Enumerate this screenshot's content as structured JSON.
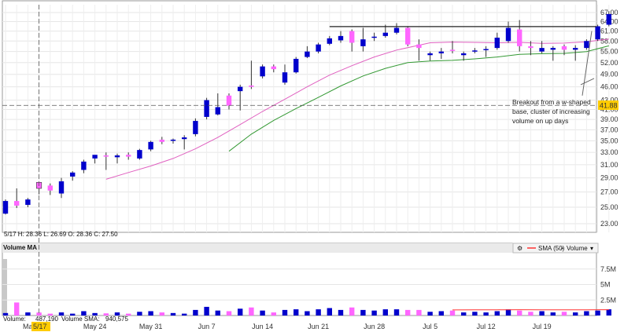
{
  "chart_data": [
    {
      "type": "candlestick",
      "title": "",
      "ylim": [
        22,
        68
      ],
      "y_ticks": [
        "23.00",
        "25.00",
        "27.00",
        "29.00",
        "31.00",
        "33.00",
        "35.00",
        "37.00",
        "39.00",
        "41.00",
        "43.00",
        "46.00",
        "49.00",
        "52.00",
        "55.00",
        "58.00",
        "61.00",
        "64.00",
        "67.00"
      ],
      "x_ticks": [
        "May 24",
        "May 31",
        "Jun 7",
        "Jun 14",
        "Jun 21",
        "Jun 28",
        "Jul 5",
        "Jul 12",
        "Jul 19"
      ],
      "crosshair_date_label": "5/17",
      "crosshair_month_fragment": "Ma",
      "highlight_price_label": "41.88",
      "info_label": "5/17  H: 28.36  L: 26.69  O: 28.36  C: 27.50",
      "candles": [
        {
          "o": 24.2,
          "h": 26.0,
          "l": 24.1,
          "c": 25.8,
          "up": true
        },
        {
          "o": 25.8,
          "h": 27.5,
          "l": 24.9,
          "c": 25.2,
          "up": false
        },
        {
          "o": 25.3,
          "h": 26.2,
          "l": 25.0,
          "c": 26.0,
          "up": true
        },
        {
          "o": 28.36,
          "h": 28.36,
          "l": 26.69,
          "c": 27.5,
          "up": false
        },
        {
          "o": 27.9,
          "h": 28.2,
          "l": 26.6,
          "c": 27.2,
          "up": false
        },
        {
          "o": 26.8,
          "h": 29.0,
          "l": 26.2,
          "c": 28.5,
          "up": true
        },
        {
          "o": 29.2,
          "h": 30.0,
          "l": 28.6,
          "c": 29.8,
          "up": true
        },
        {
          "o": 30.2,
          "h": 31.8,
          "l": 29.7,
          "c": 31.5,
          "up": true
        },
        {
          "o": 32.0,
          "h": 32.5,
          "l": 31.2,
          "c": 32.6,
          "up": true
        },
        {
          "o": 32.5,
          "h": 33.0,
          "l": 30.2,
          "c": 32.3,
          "up": false
        },
        {
          "o": 32.2,
          "h": 32.8,
          "l": 31.2,
          "c": 32.5,
          "up": true
        },
        {
          "o": 32.6,
          "h": 33.0,
          "l": 31.8,
          "c": 32.3,
          "up": false
        },
        {
          "o": 32.0,
          "h": 33.6,
          "l": 31.8,
          "c": 33.4,
          "up": true
        },
        {
          "o": 33.5,
          "h": 35.0,
          "l": 33.2,
          "c": 34.8,
          "up": true
        },
        {
          "o": 35.2,
          "h": 35.7,
          "l": 34.4,
          "c": 34.8,
          "up": false
        },
        {
          "o": 35.0,
          "h": 35.4,
          "l": 34.5,
          "c": 35.2,
          "up": true
        },
        {
          "o": 35.3,
          "h": 36.0,
          "l": 33.5,
          "c": 35.6,
          "up": true
        },
        {
          "o": 36.2,
          "h": 39.2,
          "l": 35.8,
          "c": 38.7,
          "up": true
        },
        {
          "o": 39.5,
          "h": 43.5,
          "l": 39.0,
          "c": 43.0,
          "up": true
        },
        {
          "o": 40.0,
          "h": 44.5,
          "l": 39.8,
          "c": 41.5,
          "up": true
        },
        {
          "o": 44.0,
          "h": 44.5,
          "l": 41.0,
          "c": 41.8,
          "up": false
        },
        {
          "o": 45.0,
          "h": 46.5,
          "l": 40.8,
          "c": 46.0,
          "up": true
        },
        {
          "o": 46.0,
          "h": 52.5,
          "l": 45.5,
          "c": 46.3,
          "up": false
        },
        {
          "o": 48.5,
          "h": 51.5,
          "l": 48.0,
          "c": 51.0,
          "up": true
        },
        {
          "o": 51.0,
          "h": 51.5,
          "l": 49.5,
          "c": 50.3,
          "up": false
        },
        {
          "o": 47.0,
          "h": 51.5,
          "l": 46.5,
          "c": 49.5,
          "up": true
        },
        {
          "o": 49.5,
          "h": 53.5,
          "l": 49.2,
          "c": 53.0,
          "up": true
        },
        {
          "o": 53.5,
          "h": 56.5,
          "l": 53.2,
          "c": 55.0,
          "up": true
        },
        {
          "o": 55.0,
          "h": 57.5,
          "l": 54.5,
          "c": 57.0,
          "up": true
        },
        {
          "o": 57.2,
          "h": 59.5,
          "l": 56.8,
          "c": 58.8,
          "up": true
        },
        {
          "o": 58.2,
          "h": 61.0,
          "l": 57.5,
          "c": 59.5,
          "up": true
        },
        {
          "o": 61.0,
          "h": 61.5,
          "l": 55.0,
          "c": 57.5,
          "up": false
        },
        {
          "o": 56.5,
          "h": 62.0,
          "l": 55.0,
          "c": 58.5,
          "up": true
        },
        {
          "o": 59.0,
          "h": 60.5,
          "l": 58.0,
          "c": 59.3,
          "up": true
        },
        {
          "o": 59.5,
          "h": 63.0,
          "l": 59.0,
          "c": 60.5,
          "up": true
        },
        {
          "o": 60.5,
          "h": 63.5,
          "l": 60.0,
          "c": 62.0,
          "up": true
        },
        {
          "o": 62.0,
          "h": 62.5,
          "l": 56.5,
          "c": 57.0,
          "up": false
        },
        {
          "o": 57.0,
          "h": 58.5,
          "l": 52.5,
          "c": 56.0,
          "up": false
        },
        {
          "o": 54.0,
          "h": 55.0,
          "l": 52.5,
          "c": 54.5,
          "up": true
        },
        {
          "o": 54.5,
          "h": 56.0,
          "l": 53.0,
          "c": 55.0,
          "up": true
        },
        {
          "o": 55.5,
          "h": 58.0,
          "l": 54.5,
          "c": 55.3,
          "up": false
        },
        {
          "o": 54.0,
          "h": 55.0,
          "l": 52.5,
          "c": 54.5,
          "up": true
        },
        {
          "o": 55.0,
          "h": 56.0,
          "l": 54.5,
          "c": 55.3,
          "up": true
        },
        {
          "o": 55.5,
          "h": 56.5,
          "l": 53.5,
          "c": 55.7,
          "up": true
        },
        {
          "o": 56.0,
          "h": 60.5,
          "l": 55.5,
          "c": 59.0,
          "up": true
        },
        {
          "o": 58.0,
          "h": 64.0,
          "l": 57.5,
          "c": 62.0,
          "up": true
        },
        {
          "o": 61.5,
          "h": 64.5,
          "l": 55.0,
          "c": 56.5,
          "up": false
        },
        {
          "o": 56.0,
          "h": 58.0,
          "l": 54.0,
          "c": 56.5,
          "up": false
        },
        {
          "o": 55.0,
          "h": 58.0,
          "l": 54.5,
          "c": 56.0,
          "up": true
        },
        {
          "o": 55.5,
          "h": 56.5,
          "l": 52.5,
          "c": 56.0,
          "up": true
        },
        {
          "o": 56.5,
          "h": 57.0,
          "l": 54.0,
          "c": 55.5,
          "up": false
        },
        {
          "o": 55.5,
          "h": 56.8,
          "l": 52.5,
          "c": 56.0,
          "up": true
        },
        {
          "o": 56.0,
          "h": 58.5,
          "l": 55.5,
          "c": 58.0,
          "up": true
        },
        {
          "o": 58.5,
          "h": 63.0,
          "l": 58.0,
          "c": 62.5,
          "up": true
        },
        {
          "o": 63.0,
          "h": 67.5,
          "l": 62.5,
          "c": 66.5,
          "up": true
        }
      ],
      "sma_pink": [
        [
          9,
          28.8
        ],
        [
          11,
          29.8
        ],
        [
          13,
          30.8
        ],
        [
          15,
          32.0
        ],
        [
          17,
          33.6
        ],
        [
          19,
          35.6
        ],
        [
          21,
          38.0
        ],
        [
          23,
          40.6
        ],
        [
          25,
          43.2
        ],
        [
          27,
          46.0
        ],
        [
          29,
          48.8
        ],
        [
          31,
          51.2
        ],
        [
          33,
          53.5
        ],
        [
          35,
          55.4
        ],
        [
          37,
          56.8
        ],
        [
          38,
          57.5
        ],
        [
          40,
          57.7
        ],
        [
          42,
          57.6
        ],
        [
          44,
          57.5
        ],
        [
          46,
          57.6
        ],
        [
          48,
          57.3
        ],
        [
          50,
          57.4
        ],
        [
          52,
          57.8
        ],
        [
          54,
          58.6
        ]
      ],
      "sma_green": [
        [
          20,
          33.2
        ],
        [
          22,
          36.2
        ],
        [
          24,
          38.8
        ],
        [
          26,
          41.2
        ],
        [
          28,
          43.6
        ],
        [
          30,
          46.2
        ],
        [
          32,
          48.6
        ],
        [
          34,
          50.5
        ],
        [
          36,
          52.0
        ],
        [
          38,
          52.4
        ],
        [
          40,
          52.6
        ],
        [
          42,
          53.0
        ],
        [
          44,
          53.5
        ],
        [
          46,
          54.2
        ],
        [
          48,
          54.4
        ],
        [
          50,
          54.5
        ],
        [
          52,
          55.0
        ],
        [
          54,
          56.6
        ]
      ],
      "resistance_level": 62.4,
      "crosshair_price": 41.88,
      "annotation": [
        "Breakout from a w-shaped",
        "base, cluster of increasing",
        "volume on up days"
      ]
    },
    {
      "type": "bar",
      "title": "Volume MA",
      "legend": [
        "SMA (50)",
        "Volume"
      ],
      "y_ticks": [
        "2.5M",
        "5M",
        "7.5M"
      ],
      "ylim": [
        0,
        10000000
      ],
      "volume_label": "Volume:",
      "volume_value": "487,190",
      "sma_label": "Volume SMA:",
      "sma_value": "940,575",
      "volumes": [
        400000,
        2100000,
        500000,
        487190,
        300000,
        500000,
        300000,
        700000,
        400000,
        350000,
        500000,
        300000,
        600000,
        700000,
        500000,
        400000,
        300000,
        900000,
        1400000,
        800000,
        700000,
        1100000,
        1300000,
        800000,
        500000,
        900000,
        1000000,
        700000,
        1000000,
        1200000,
        900000,
        1300000,
        900000,
        800000,
        1000000,
        1000000,
        900000,
        900000,
        600000,
        700000,
        800000,
        500000,
        600000,
        500000,
        700000,
        1000000,
        800000,
        600000,
        700000,
        500000,
        600000,
        500000,
        700000,
        800000,
        1000000
      ],
      "sma50": [
        [
          40,
          900000
        ],
        [
          42,
          920000
        ],
        [
          44,
          930000
        ],
        [
          46,
          940000
        ],
        [
          48,
          930000
        ],
        [
          50,
          920000
        ],
        [
          52,
          930000
        ],
        [
          54,
          940575
        ]
      ]
    }
  ],
  "colors": {
    "up": "#0000cc",
    "down": "#ff66ff",
    "sma_pink": "#e060c0",
    "sma_green": "#339933",
    "highlight": "#ffcc00",
    "resistance": "#222222"
  }
}
